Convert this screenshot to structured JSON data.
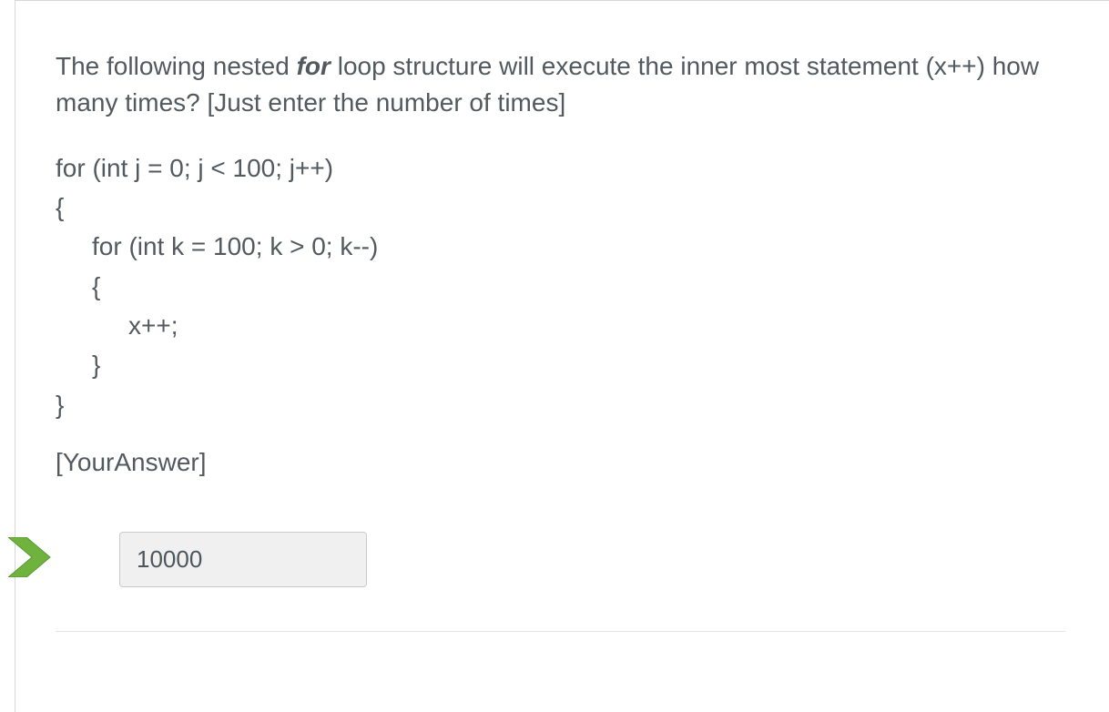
{
  "question": {
    "intro_prefix": "The following nested ",
    "for_word": "for",
    "intro_suffix": " loop structure will execute the inner most statement (x++) how many times? [Just enter the number of times]"
  },
  "code": {
    "l1": "for (int j = 0; j < 100; j++)",
    "l2": "{",
    "l3": "for (int k = 100; k > 0; k--)",
    "l4": "{",
    "l5": "x++;",
    "l6": "}",
    "l7": "}"
  },
  "answer_label": "[YourAnswer]",
  "answer_value": "10000"
}
